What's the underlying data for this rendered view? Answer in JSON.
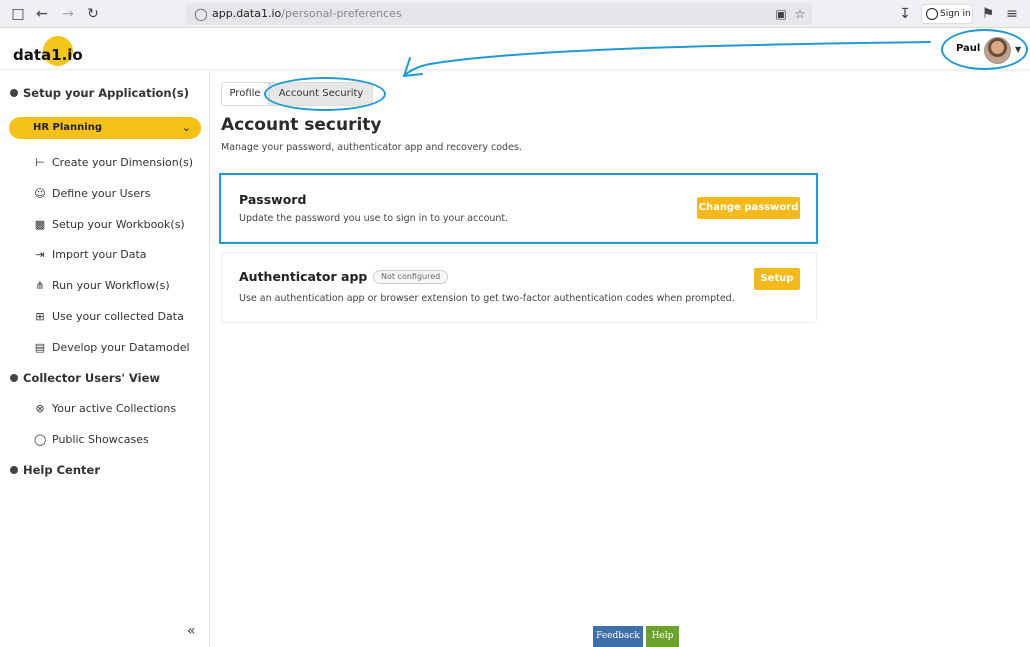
{
  "browser": {
    "url_domain": "app.data1.io",
    "url_path": "/personal-preferences",
    "signin_label": "Sign in"
  },
  "header": {
    "logo": "data1.io",
    "user_name": "Paul"
  },
  "sidebar": {
    "setup_section": "Setup your Application(s)",
    "active_app": "HR Planning",
    "setup_items": [
      {
        "label": "Create your Dimension(s)",
        "icon": "hierarchy-icon"
      },
      {
        "label": "Define your Users",
        "icon": "user-icon"
      },
      {
        "label": "Setup your Workbook(s)",
        "icon": "workbook-icon"
      },
      {
        "label": "Import your Data",
        "icon": "import-icon"
      },
      {
        "label": "Run your Workflow(s)",
        "icon": "workflow-icon"
      },
      {
        "label": "Use your collected Data",
        "icon": "table-icon"
      },
      {
        "label": "Develop your Datamodel",
        "icon": "datamodel-icon"
      }
    ],
    "collector_section": "Collector Users' View",
    "collector_items": [
      {
        "label": "Your active Collections",
        "icon": "lifebuoy-icon"
      },
      {
        "label": "Public Showcases",
        "icon": "lightbulb-icon"
      }
    ],
    "help_section": "Help Center"
  },
  "main": {
    "tabs": [
      {
        "label": "Profile",
        "active": false
      },
      {
        "label": "Account Security",
        "active": true
      }
    ],
    "title": "Account security",
    "subtitle": "Manage your password, authenticator app and recovery codes.",
    "password_card": {
      "title": "Password",
      "description": "Update the password you use to sign in to your account.",
      "button": "Change password"
    },
    "authenticator_card": {
      "title": "Authenticator app",
      "badge": "Not configured",
      "description": "Use an authentication app or browser extension to get two-factor authentication codes when prompted.",
      "button": "Setup"
    }
  },
  "footer": {
    "feedback": "Feedback",
    "help": "Help"
  },
  "colors": {
    "accent_yellow": "#f6c117",
    "annotation_blue": "#1e9bd6",
    "feedback_blue": "#3f6fa8",
    "help_green": "#6aa32a"
  }
}
